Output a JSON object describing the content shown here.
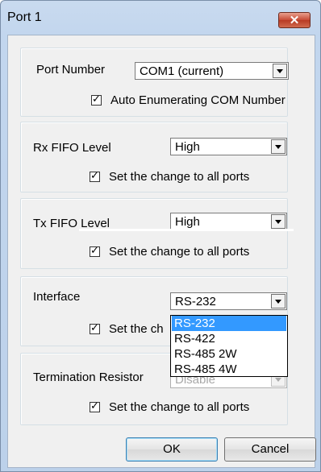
{
  "window": {
    "title": "Port 1",
    "close_glyph": "✕"
  },
  "port_number": {
    "label": "Port Number",
    "value": "COM1 (current)",
    "checkbox_label": "Auto Enumerating COM Number",
    "checked": true
  },
  "rx_fifo": {
    "label": "Rx FIFO Level",
    "value": "High",
    "checkbox_label": "Set the change to all ports",
    "checked": true
  },
  "tx_fifo": {
    "label": "Tx FIFO Level",
    "value": "High",
    "checkbox_label": "Set the change to all ports",
    "checked": true
  },
  "interface": {
    "label": "Interface",
    "value": "RS-232",
    "checkbox_label": "Set the ch",
    "checked": true,
    "options": [
      "RS-232",
      "RS-422",
      "RS-485 2W",
      "RS-485 4W"
    ],
    "highlighted_option": "RS-232"
  },
  "termination": {
    "label": "Termination Resistor",
    "value": "Disable",
    "checkbox_label": "Set the change to all ports",
    "checked": true
  },
  "buttons": {
    "ok": "OK",
    "cancel": "Cancel"
  }
}
